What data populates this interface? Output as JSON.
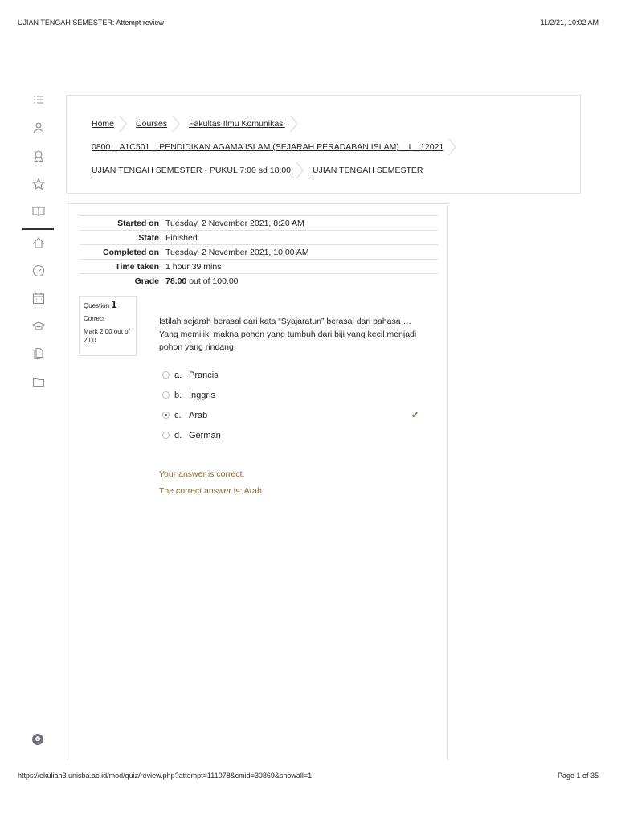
{
  "print": {
    "title": "UJIAN TENGAH SEMESTER: Attempt review",
    "datetime": "11/2/21, 10:02 AM",
    "url": "https://ekuliah3.unisba.ac.id/mod/quiz/review.php?attempt=111078&cmid=30869&showall=1",
    "page": "Page 1 of 35"
  },
  "sidebar_icons": [
    "list-icon",
    "user-icon",
    "badge-icon",
    "star-icon",
    "book-icon",
    "home-icon",
    "dashboard-icon",
    "calendar-icon",
    "graduation-cap-icon",
    "files-icon",
    "folder-icon"
  ],
  "breadcrumb": {
    "row1": [
      "Home",
      "Courses",
      "Fakultas Ilmu Komunikasi"
    ],
    "row2": [
      "0800 _ A1C501 _ PENDIDIKAN AGAMA ISLAM (SEJARAH PERADABAN ISLAM) _ I _ 12021"
    ],
    "row3": [
      "UJIAN TENGAH SEMESTER - PUKUL 7:00 sd 18:00",
      "UJIAN TENGAH SEMESTER"
    ]
  },
  "summary": [
    {
      "label": "Started on",
      "value": "Tuesday, 2 November 2021, 8:20 AM"
    },
    {
      "label": "State",
      "value": "Finished"
    },
    {
      "label": "Completed on",
      "value": "Tuesday, 2 November 2021, 10:00 AM"
    },
    {
      "label": "Time taken",
      "value": "1 hour 39 mins"
    }
  ],
  "grade": {
    "label": "Grade",
    "score": "78.00",
    "rest": "out of 100.00"
  },
  "question": {
    "prefix": "Question",
    "number": "1",
    "status": "Correct",
    "mark": "Mark 2.00 out of 2.00",
    "text": "Istilah sejarah berasal dari kata “Syajaratun” berasal dari bahasa … Yang memiliki makna pohon yang tumbuh dari biji yang kecil menjadi pohon yang rindang.",
    "answers": [
      {
        "letter": "a.",
        "text": "Prancis",
        "selected": false
      },
      {
        "letter": "b.",
        "text": "Inggris",
        "selected": false
      },
      {
        "letter": "c.",
        "text": "Arab",
        "selected": true,
        "correct": true
      },
      {
        "letter": "d.",
        "text": "German",
        "selected": false
      }
    ],
    "feedback": "Your answer is correct.",
    "right_answer": "The correct answer is: Arab"
  },
  "colors": {
    "feedback": "#8e662e",
    "check": "#357a32",
    "border": "#dee2e6"
  }
}
